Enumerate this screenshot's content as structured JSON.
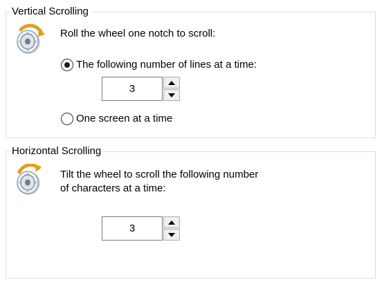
{
  "vertical": {
    "legend": "Vertical Scrolling",
    "icon": "mouse-wheel-icon",
    "instruction": "Roll the wheel one notch to scroll:",
    "option_lines": {
      "label": "The following number of lines at a time:",
      "selected": true
    },
    "lines_value": "3",
    "option_screen": {
      "label": "One screen at a time",
      "selected": false
    }
  },
  "horizontal": {
    "legend": "Horizontal Scrolling",
    "icon": "mouse-wheel-icon",
    "instruction_line1": "Tilt the wheel to scroll the following number",
    "instruction_line2": "of characters at a time:",
    "chars_value": "3"
  },
  "colors": {
    "group_border": "#d5dfe5",
    "icon_wheel_body": "#eef1f4",
    "icon_wheel_ring": "#6b7f92",
    "icon_arrow": "#e0a01e"
  }
}
